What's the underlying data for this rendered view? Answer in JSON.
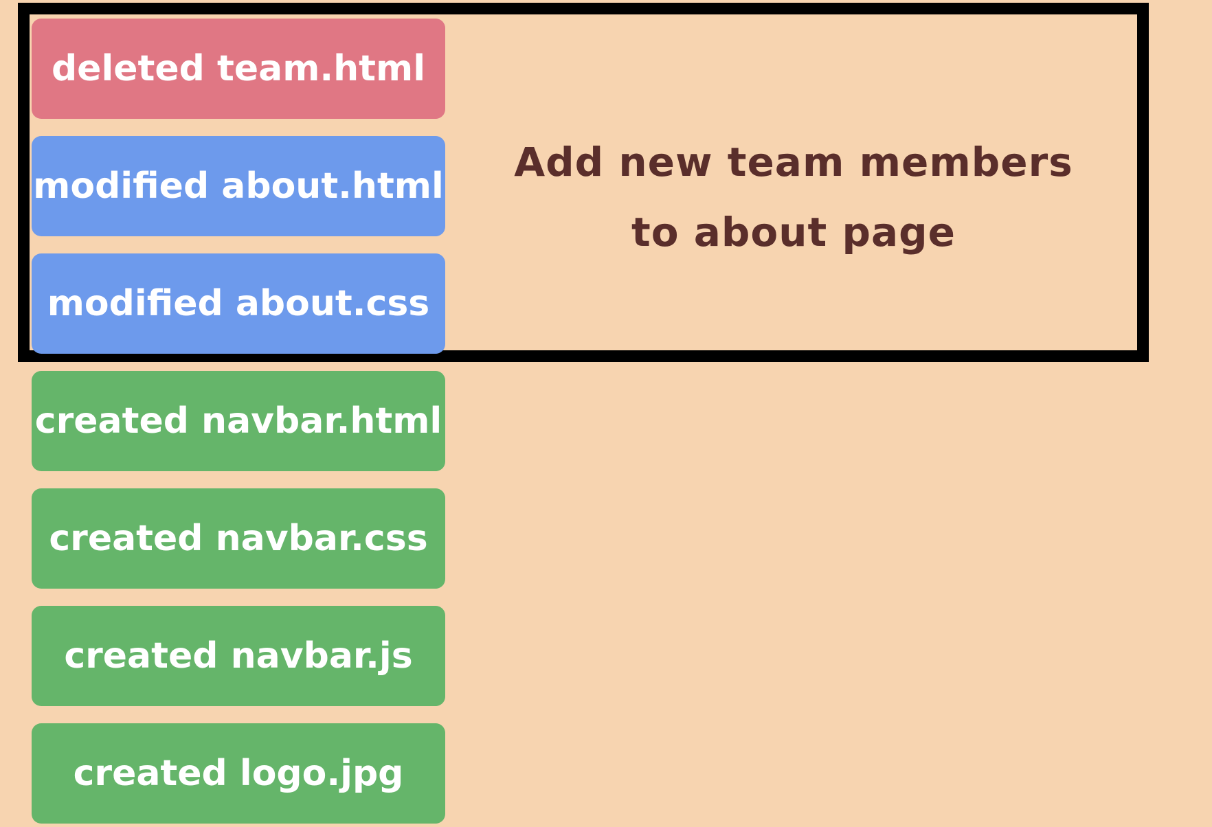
{
  "colors": {
    "background": "#f7d4b0",
    "deleted": "#e07784",
    "modified": "#6d9aec",
    "created": "#65b56a",
    "commit_border": "#000000",
    "commit_text": "#5a2e2b"
  },
  "commit": {
    "message_line1": "Add new team members",
    "message_line2": "to about page"
  },
  "changes": [
    {
      "status": "deleted",
      "label": "deleted team.html"
    },
    {
      "status": "modified",
      "label": "modified about.html"
    },
    {
      "status": "modified",
      "label": "modified about.css"
    },
    {
      "status": "created",
      "label": "created navbar.html"
    },
    {
      "status": "created",
      "label": "created navbar.css"
    },
    {
      "status": "created",
      "label": "created navbar.js"
    },
    {
      "status": "created",
      "label": "created logo.jpg"
    }
  ]
}
